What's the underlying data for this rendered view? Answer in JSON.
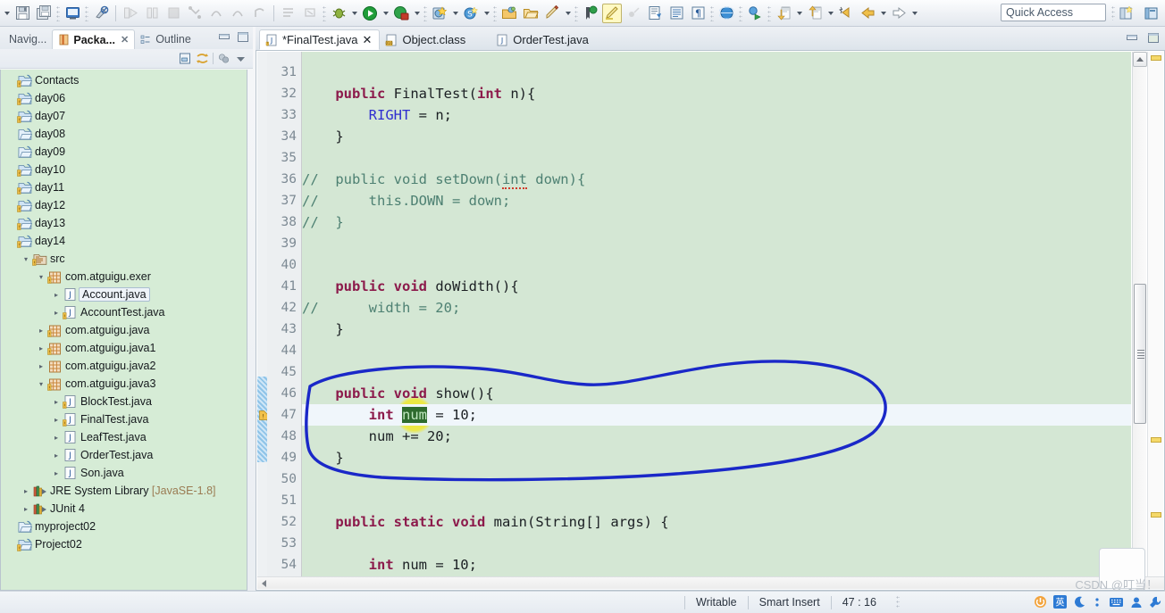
{
  "toolbar": {
    "quick_access": "Quick Access",
    "buttons": [
      {
        "name": "new-wizard-dropdown",
        "icon": "chevron-down-icon"
      },
      {
        "name": "save-button",
        "icon": "save-icon"
      },
      {
        "name": "save-all-button",
        "icon": "save-all-icon"
      },
      {
        "name": "print-button",
        "icon": "print-icon"
      },
      {
        "name": "toggle-mark-occurrences-button",
        "icon": "mark-occurrences-icon"
      },
      {
        "name": "run-last-tool-button",
        "icon": "run-external-icon"
      },
      {
        "name": "pause-button",
        "icon": "pause-icon"
      },
      {
        "name": "terminate-button",
        "icon": "stop-icon"
      },
      {
        "name": "step-into-button",
        "icon": "step-into-icon"
      },
      {
        "name": "step-over-button",
        "icon": "step-over-icon"
      },
      {
        "name": "step-return-button",
        "icon": "step-return-icon"
      },
      {
        "name": "resume-button",
        "icon": "resume-icon"
      },
      {
        "name": "new-java-package-button",
        "icon": "package-icon"
      },
      {
        "name": "new-java-class-button",
        "icon": "class-icon"
      },
      {
        "name": "debug-button",
        "icon": "debug-bug-icon"
      },
      {
        "name": "run-button",
        "icon": "run-green-icon"
      },
      {
        "name": "coverage-button",
        "icon": "coverage-icon"
      },
      {
        "name": "new-java-project-button",
        "icon": "new-project-icon"
      },
      {
        "name": "search-button",
        "icon": "search-blue-icon"
      },
      {
        "name": "open-type-button",
        "icon": "open-type-icon"
      },
      {
        "name": "open-task-button",
        "icon": "open-folder-icon"
      },
      {
        "name": "edit-task-button",
        "icon": "pencil-icon"
      },
      {
        "name": "toggle-breakpoint-button",
        "icon": "breakpoint-icon"
      },
      {
        "name": "highlight-button",
        "icon": "highlighter-icon"
      },
      {
        "name": "annotation-button",
        "icon": "annotation-icon"
      },
      {
        "name": "open-editor-button",
        "icon": "java-editor-icon"
      },
      {
        "name": "show-view-button",
        "icon": "show-view-icon"
      },
      {
        "name": "paragraph-button",
        "icon": "paragraph-icon"
      },
      {
        "name": "open-web-browser-button",
        "icon": "globe-icon"
      },
      {
        "name": "external-tools-button",
        "icon": "external-tools-icon"
      },
      {
        "name": "next-annotation-button",
        "icon": "next-annotation-icon"
      },
      {
        "name": "previous-annotation-button",
        "icon": "previous-annotation-icon"
      },
      {
        "name": "last-edit-location-button",
        "icon": "last-edit-icon"
      },
      {
        "name": "back-button",
        "icon": "back-arrow-icon"
      },
      {
        "name": "forward-button",
        "icon": "forward-arrow-icon"
      }
    ],
    "perspective_new": "open-perspective-icon",
    "perspective_java": "java-perspective-icon"
  },
  "left_view": {
    "tabs": [
      {
        "label": "Navig...",
        "active": false,
        "closable": false,
        "icon": "navigator-icon"
      },
      {
        "label": "Packa...",
        "active": true,
        "closable": true,
        "icon": "package-explorer-icon"
      },
      {
        "label": "Outline",
        "active": false,
        "closable": false,
        "icon": "outline-icon"
      }
    ],
    "view_controls": [
      {
        "name": "minimize-view-button",
        "icon": "minimize-icon"
      },
      {
        "name": "maximize-view-button",
        "icon": "maximize-icon"
      }
    ],
    "toolbar_buttons": [
      {
        "name": "collapse-all-button",
        "icon": "collapse-all-icon"
      },
      {
        "name": "link-with-editor-button",
        "icon": "link-editor-icon"
      },
      {
        "name": "focus-on-active-task-button",
        "icon": "focus-task-icon"
      },
      {
        "name": "view-menu-button",
        "icon": "view-menu-icon"
      }
    ],
    "tree": [
      {
        "label": "Contacts",
        "indent": 0,
        "twist": "",
        "icon": "project-closed-icon",
        "warn": true
      },
      {
        "label": "day06",
        "indent": 0,
        "twist": "",
        "icon": "project-closed-icon",
        "warn": true
      },
      {
        "label": "day07",
        "indent": 0,
        "twist": "",
        "icon": "project-closed-icon",
        "warn": true
      },
      {
        "label": "day08",
        "indent": 0,
        "twist": "",
        "icon": "project-plain-icon",
        "warn": false
      },
      {
        "label": "day09",
        "indent": 0,
        "twist": "",
        "icon": "project-plain-icon",
        "warn": false
      },
      {
        "label": "day10",
        "indent": 0,
        "twist": "",
        "icon": "project-closed-icon",
        "warn": true
      },
      {
        "label": "day11",
        "indent": 0,
        "twist": "",
        "icon": "project-closed-icon",
        "warn": true
      },
      {
        "label": "day12",
        "indent": 0,
        "twist": "",
        "icon": "project-closed-icon",
        "warn": true
      },
      {
        "label": "day13",
        "indent": 0,
        "twist": "",
        "icon": "project-closed-icon",
        "warn": true
      },
      {
        "label": "day14",
        "indent": 0,
        "twist": "",
        "icon": "project-closed-icon",
        "warn": true
      },
      {
        "label": "src",
        "indent": 1,
        "twist": "▾",
        "icon": "source-folder-icon",
        "warn": true
      },
      {
        "label": "com.atguigu.exer",
        "indent": 2,
        "twist": "▾",
        "icon": "package-icon",
        "warn": true
      },
      {
        "label": "Account.java",
        "indent": 3,
        "twist": "▸",
        "icon": "java-file-icon",
        "warn": false,
        "selected": true
      },
      {
        "label": "AccountTest.java",
        "indent": 3,
        "twist": "▸",
        "icon": "java-file-icon",
        "warn": true
      },
      {
        "label": "com.atguigu.java",
        "indent": 2,
        "twist": "▸",
        "icon": "package-icon",
        "warn": true
      },
      {
        "label": "com.atguigu.java1",
        "indent": 2,
        "twist": "▸",
        "icon": "package-icon",
        "warn": true
      },
      {
        "label": "com.atguigu.java2",
        "indent": 2,
        "twist": "▸",
        "icon": "package-icon",
        "warn": false
      },
      {
        "label": "com.atguigu.java3",
        "indent": 2,
        "twist": "▾",
        "icon": "package-icon",
        "warn": true
      },
      {
        "label": "BlockTest.java",
        "indent": 3,
        "twist": "▸",
        "icon": "java-file-icon",
        "warn": true
      },
      {
        "label": "FinalTest.java",
        "indent": 3,
        "twist": "▸",
        "icon": "java-file-icon",
        "warn": true
      },
      {
        "label": "LeafTest.java",
        "indent": 3,
        "twist": "▸",
        "icon": "java-file-icon",
        "warn": false
      },
      {
        "label": "OrderTest.java",
        "indent": 3,
        "twist": "▸",
        "icon": "java-file-icon",
        "warn": false
      },
      {
        "label": "Son.java",
        "indent": 3,
        "twist": "▸",
        "icon": "java-file-icon",
        "warn": false
      },
      {
        "label": "JRE System Library",
        "sub": "[JavaSE-1.8]",
        "indent": 1,
        "twist": "▸",
        "icon": "library-icon",
        "warn": false
      },
      {
        "label": "JUnit 4",
        "indent": 1,
        "twist": "▸",
        "icon": "library-icon",
        "warn": false
      },
      {
        "label": "myproject02",
        "indent": 0,
        "twist": "",
        "icon": "project-plain-icon",
        "warn": false
      },
      {
        "label": "Project02",
        "indent": 0,
        "twist": "",
        "icon": "project-closed-icon",
        "warn": true
      }
    ]
  },
  "editor": {
    "tabs": [
      {
        "label": "*FinalTest.java",
        "active": true,
        "closable": true,
        "icon": "java-file-icon"
      },
      {
        "label": "Object.class",
        "active": false,
        "closable": false,
        "icon": "class-file-icon"
      },
      {
        "label": "OrderTest.java",
        "active": false,
        "closable": false,
        "icon": "java-file-icon"
      }
    ],
    "controls": [
      {
        "name": "minimize-editor-button",
        "icon": "minimize-icon"
      },
      {
        "name": "maximize-editor-button",
        "icon": "maximize-icon"
      }
    ],
    "first_line": 31,
    "cursor_line": 47,
    "lines": [
      {
        "n": 31,
        "fold": false,
        "text": ""
      },
      {
        "n": 32,
        "fold": true,
        "text": "    public FinalTest(int n){"
      },
      {
        "n": 33,
        "fold": false,
        "text": "        RIGHT = n;"
      },
      {
        "n": 34,
        "fold": false,
        "text": "    }"
      },
      {
        "n": 35,
        "fold": false,
        "text": ""
      },
      {
        "n": 36,
        "fold": false,
        "text": "//  public void setDown(int down){"
      },
      {
        "n": 37,
        "fold": false,
        "text": "//      this.DOWN = down;"
      },
      {
        "n": 38,
        "fold": false,
        "text": "//  }"
      },
      {
        "n": 39,
        "fold": false,
        "text": ""
      },
      {
        "n": 40,
        "fold": false,
        "text": ""
      },
      {
        "n": 41,
        "fold": true,
        "text": "    public void doWidth(){"
      },
      {
        "n": 42,
        "fold": false,
        "text": "//      width = 20;"
      },
      {
        "n": 43,
        "fold": false,
        "text": "    }"
      },
      {
        "n": 44,
        "fold": false,
        "text": ""
      },
      {
        "n": 45,
        "fold": false,
        "text": ""
      },
      {
        "n": 46,
        "fold": true,
        "text": "    public void show(){"
      },
      {
        "n": 47,
        "fold": false,
        "text": "        int num = 10;",
        "current": true,
        "warn": true
      },
      {
        "n": 48,
        "fold": false,
        "text": "        num += 20;"
      },
      {
        "n": 49,
        "fold": false,
        "text": "    }"
      },
      {
        "n": 50,
        "fold": false,
        "text": ""
      },
      {
        "n": 51,
        "fold": false,
        "text": ""
      },
      {
        "n": 52,
        "fold": true,
        "text": "    public static void main(String[] args) {"
      },
      {
        "n": 53,
        "fold": false,
        "text": ""
      },
      {
        "n": 54,
        "fold": false,
        "text": "        int num = 10;"
      }
    ],
    "selected_token": "num",
    "annotation": {
      "shape": "hand-drawn-ellipse",
      "color": "#1a28c8"
    }
  },
  "statusbar": {
    "writable": "Writable",
    "insert_mode": "Smart Insert",
    "position": "47 : 16"
  },
  "watermark": "CSDN @叮当！",
  "colors": {
    "editor_background": "#d4e7d4",
    "current_line": "#f0f6fb",
    "keyword": "#8c1a4b",
    "comment": "#4d8072",
    "constant": "#2e2ed0",
    "selection": "#2e6b2e",
    "cursor_glow": "#f0e828",
    "annotation": "#1a28c8",
    "tree_background": "#d6ecd6"
  }
}
